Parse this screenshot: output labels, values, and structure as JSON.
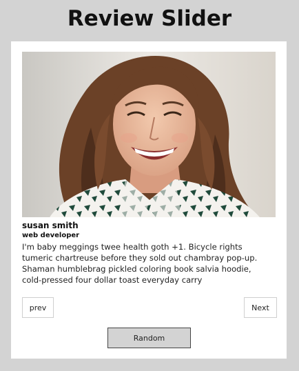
{
  "header": {
    "title": "Review Slider"
  },
  "review": {
    "photo_icon": "portrait-photo",
    "name": "susan smith",
    "job": "web developer",
    "text": "I'm baby meggings twee health goth +1. Bicycle rights tumeric chartreuse before they sold out chambray pop-up. Shaman humblebrag pickled coloring book salvia hoodie, cold-pressed four dollar toast everyday carry"
  },
  "controls": {
    "prev_label": "prev",
    "next_label": "Next",
    "random_label": "Random"
  },
  "colors": {
    "page_background": "#d3d3d3",
    "card_background": "#ffffff",
    "random_button_background": "#d3d3d3"
  }
}
